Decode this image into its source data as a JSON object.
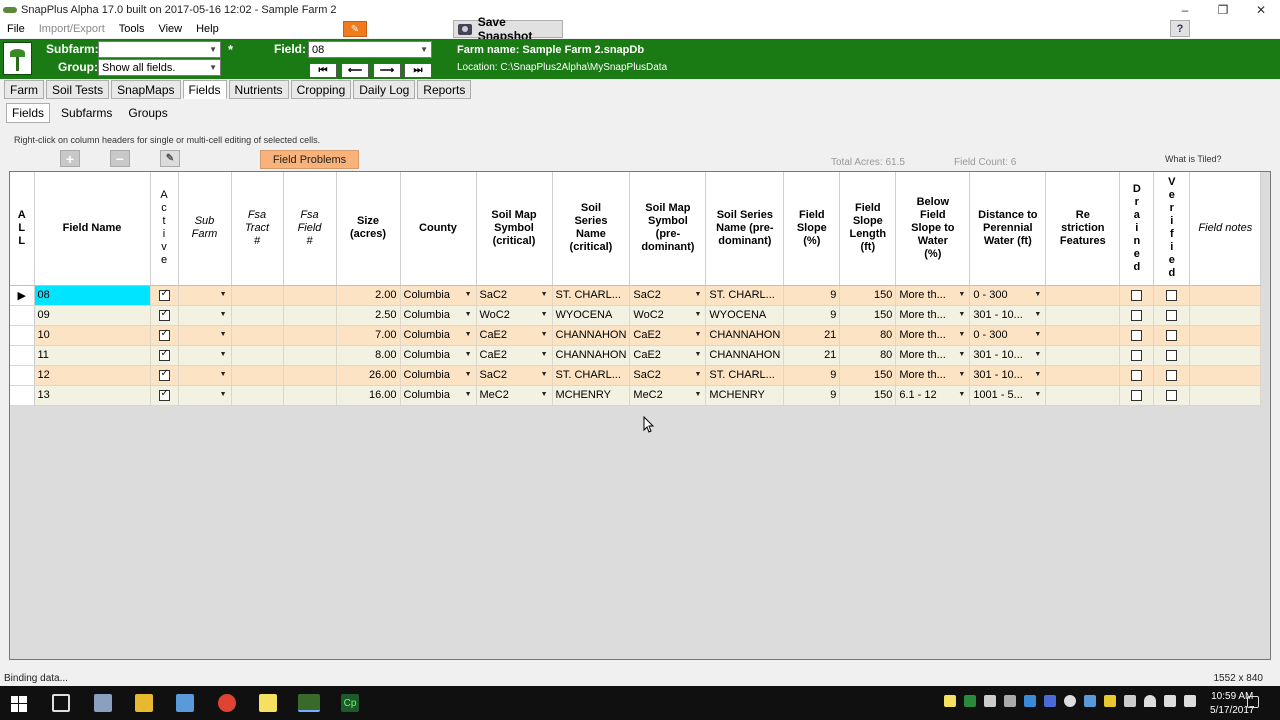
{
  "window": {
    "title": "SnapPlus Alpha 17.0 built on 2017-05-16 12:02 - Sample Farm 2",
    "minimize": "–",
    "maximize": "❐",
    "close": "✕"
  },
  "menu": [
    "File",
    "Import/Export",
    "Tools",
    "View",
    "Help"
  ],
  "toolbar": {
    "save_snapshot": "Save Snapshot",
    "help": "?"
  },
  "header": {
    "subfarm_label": "Subfarm:",
    "subfarm_value": "",
    "group_label": "Group:",
    "group_value": "Show all fields.",
    "star": "*",
    "field_label": "Field:",
    "field_value": "08",
    "farm_name": "Farm name: Sample Farm 2.snapDb",
    "location": "Location: C:\\SnapPlus2Alpha\\MySnapPlusData"
  },
  "tabs": [
    "Farm",
    "Soil Tests",
    "SnapMaps",
    "Fields",
    "Nutrients",
    "Cropping",
    "Daily Log",
    "Reports"
  ],
  "active_tab": "Fields",
  "subtabs": [
    "Fields",
    "Subfarms",
    "Groups"
  ],
  "active_subtab": "Fields",
  "hint": "Right-click on column headers for single or multi-cell editing of selected cells.",
  "field_problems": "Field Problems",
  "total_acres": "Total Acres: 61.5",
  "field_count": "Field Count:  6",
  "what_is_tiled": "What is Tiled?",
  "columns": {
    "all": "A\nL\nL",
    "field_name": "Field Name",
    "active": "A\nc\nt\ni\nv\ne",
    "sub_farm": "Sub\nFarm",
    "fsa_tract": "Fsa\nTract\n#",
    "fsa_field": "Fsa\nField\n#",
    "size": "Size\n(acres)",
    "county": "County",
    "soil_map_symbol_critical": "Soil Map\nSymbol\n(critical)",
    "soil_series_critical": "Soil\nSeries\nName\n(critical)",
    "soil_map_symbol_predominant": "Soil Map\nSymbol\n(pre-\ndominant)",
    "soil_series_predominant": "Soil Series\nName (pre-\ndominant)",
    "field_slope": "Field\nSlope\n(%)",
    "field_slope_length": "Field\nSlope\nLength\n(ft)",
    "below_field_slope": "Below\nField\nSlope to\nWater\n(%)",
    "distance_to_water": "Distance to\nPerennial\nWater (ft)",
    "restriction_features": "Re\nstriction\nFeatures",
    "drained": "D\nr\na\ni\nn\ne\nd",
    "verified": "V\ne\nr\ni\nf\ni\ne\nd",
    "field_notes": "Field notes"
  },
  "rows": [
    {
      "name": "08",
      "active": true,
      "size": "2.00",
      "county": "Columbia",
      "sms_crit": "SaC2",
      "ss_crit": "ST. CHARL...",
      "sms_pre": "SaC2",
      "ss_pre": "ST. CHARL...",
      "slope": "9",
      "slope_len": "150",
      "below": "More th...",
      "dist": "0 - 300",
      "drained": false,
      "verified": false
    },
    {
      "name": "09",
      "active": true,
      "size": "2.50",
      "county": "Columbia",
      "sms_crit": "WoC2",
      "ss_crit": "WYOCENA",
      "sms_pre": "WoC2",
      "ss_pre": "WYOCENA",
      "slope": "9",
      "slope_len": "150",
      "below": "More th...",
      "dist": "301 - 10...",
      "drained": false,
      "verified": false
    },
    {
      "name": "10",
      "active": true,
      "size": "7.00",
      "county": "Columbia",
      "sms_crit": "CaE2",
      "ss_crit": "CHANNAHON",
      "sms_pre": "CaE2",
      "ss_pre": "CHANNAHON",
      "slope": "21",
      "slope_len": "80",
      "below": "More th...",
      "dist": "0 - 300",
      "drained": false,
      "verified": false
    },
    {
      "name": "11",
      "active": true,
      "size": "8.00",
      "county": "Columbia",
      "sms_crit": "CaE2",
      "ss_crit": "CHANNAHON",
      "sms_pre": "CaE2",
      "ss_pre": "CHANNAHON",
      "slope": "21",
      "slope_len": "80",
      "below": "More th...",
      "dist": "301 - 10...",
      "drained": false,
      "verified": false
    },
    {
      "name": "12",
      "active": true,
      "size": "26.00",
      "county": "Columbia",
      "sms_crit": "SaC2",
      "ss_crit": "ST. CHARL...",
      "sms_pre": "SaC2",
      "ss_pre": "ST. CHARL...",
      "slope": "9",
      "slope_len": "150",
      "below": "More th...",
      "dist": "301 - 10...",
      "drained": false,
      "verified": false
    },
    {
      "name": "13",
      "active": true,
      "size": "16.00",
      "county": "Columbia",
      "sms_crit": "MeC2",
      "ss_crit": "MCHENRY",
      "sms_pre": "MeC2",
      "ss_pre": "MCHENRY",
      "slope": "9",
      "slope_len": "150",
      "below": "6.1 - 12",
      "dist": "1001 - 5...",
      "drained": false,
      "verified": false
    }
  ],
  "status": {
    "text": "Binding data...",
    "resolution": "1552 x 840"
  },
  "taskbar": {
    "time": "10:59 AM",
    "date": "5/17/2017"
  },
  "colors": {
    "header_green": "#1a7a14",
    "row_orange": "#fce3c4",
    "row_cream": "#f3f1e1",
    "selection_cyan": "#00e4ff",
    "field_problems_bg": "#f8b27a"
  }
}
